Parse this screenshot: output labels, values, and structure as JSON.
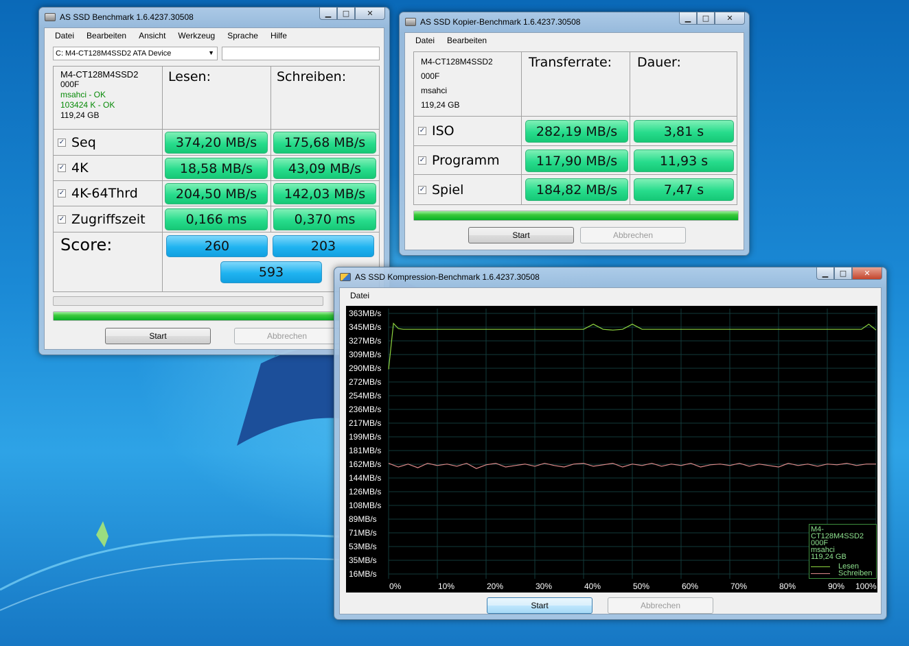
{
  "main_window": {
    "title": "AS SSD Benchmark 1.6.4237.30508",
    "menu": [
      "Datei",
      "Bearbeiten",
      "Ansicht",
      "Werkzeug",
      "Sprache",
      "Hilfe"
    ],
    "drive_select": "C: M4-CT128M4SSD2 ATA Device",
    "device_info": {
      "model": "M4-CT128M4SSD2",
      "firmware": "000F",
      "driver": "msahci - OK",
      "alignment": "103424 K - OK",
      "size": "119,24 GB"
    },
    "col_read": "Lesen:",
    "col_write": "Schreiben:",
    "rows": [
      {
        "label": "Seq",
        "read": "374,20 MB/s",
        "write": "175,68 MB/s"
      },
      {
        "label": "4K",
        "read": "18,58 MB/s",
        "write": "43,09 MB/s"
      },
      {
        "label": "4K-64Thrd",
        "read": "204,50 MB/s",
        "write": "142,03 MB/s"
      },
      {
        "label": "Zugriffszeit",
        "read": "0,166 ms",
        "write": "0,370 ms"
      }
    ],
    "score_label": "Score:",
    "score_read": "260",
    "score_write": "203",
    "score_total": "593",
    "progress_fraction": 1.0,
    "start_label": "Start",
    "abort_label": "Abbrechen"
  },
  "copy_window": {
    "title": "AS SSD Kopier-Benchmark 1.6.4237.30508",
    "menu": [
      "Datei",
      "Bearbeiten"
    ],
    "device_info": {
      "model": "M4-CT128M4SSD2",
      "firmware": "000F",
      "driver": "msahci",
      "size": "119,24 GB"
    },
    "col_rate": "Transferrate:",
    "col_time": "Dauer:",
    "rows": [
      {
        "label": "ISO",
        "rate": "282,19 MB/s",
        "time": "3,81 s"
      },
      {
        "label": "Programm",
        "rate": "117,90 MB/s",
        "time": "11,93 s"
      },
      {
        "label": "Spiel",
        "rate": "184,82 MB/s",
        "time": "7,47 s"
      }
    ],
    "progress_fraction": 1.0,
    "start_label": "Start",
    "abort_label": "Abbrechen"
  },
  "compression_window": {
    "title": "AS SSD Kompression-Benchmark 1.6.4237.30508",
    "menu": [
      "Datei"
    ],
    "start_label": "Start",
    "abort_label": "Abbrechen",
    "legend": {
      "model": "M4-CT128M4SSD2",
      "firmware": "000F",
      "driver": "msahci",
      "size": "119,24 GB",
      "read_label": "Lesen",
      "write_label": "Schreiben"
    }
  },
  "colors": {
    "read_line": "#8fd640",
    "write_line": "#e08a8a",
    "grid": "#123a3a",
    "pill_green": "#27dc8c",
    "pill_blue": "#1fb3f0",
    "progress_green": "#06b025"
  },
  "chart_data": {
    "type": "line",
    "xlabel": "",
    "ylabel": "",
    "y_tick_labels": [
      "363MB/s",
      "345MB/s",
      "327MB/s",
      "309MB/s",
      "290MB/s",
      "272MB/s",
      "254MB/s",
      "236MB/s",
      "217MB/s",
      "199MB/s",
      "181MB/s",
      "162MB/s",
      "144MB/s",
      "126MB/s",
      "108MB/s",
      "89MB/s",
      "71MB/s",
      "53MB/s",
      "35MB/s",
      "16MB/s"
    ],
    "x_tick_labels": [
      "0%",
      "10%",
      "20%",
      "30%",
      "40%",
      "50%",
      "60%",
      "70%",
      "80%",
      "90%",
      "100%"
    ],
    "x_tick_values": [
      0,
      10,
      20,
      30,
      40,
      50,
      60,
      70,
      80,
      90,
      100
    ],
    "xlim": [
      0,
      100
    ],
    "ylim": [
      7,
      372
    ],
    "grid": true,
    "legend_position": "bottom-right",
    "series": [
      {
        "name": "Lesen",
        "x": [
          0,
          1,
          2,
          3,
          5,
          10,
          20,
          30,
          40,
          42,
          44,
          46,
          48,
          50,
          52,
          60,
          70,
          80,
          90,
          95,
          97,
          98.5,
          100
        ],
        "y": [
          290,
          352,
          345,
          344,
          344,
          344,
          344,
          344,
          344,
          351,
          344,
          343,
          344,
          351,
          344,
          344,
          344,
          344,
          344,
          344,
          344,
          351,
          343
        ]
      },
      {
        "name": "Schreiben",
        "x": [
          0,
          2,
          4,
          6,
          8,
          10,
          12,
          14,
          16,
          18,
          20,
          22,
          24,
          26,
          28,
          30,
          32,
          34,
          36,
          38,
          40,
          42,
          44,
          46,
          48,
          50,
          52,
          54,
          56,
          58,
          60,
          62,
          64,
          66,
          68,
          70,
          72,
          74,
          76,
          78,
          80,
          82,
          84,
          86,
          88,
          90,
          92,
          94,
          96,
          98,
          100
        ],
        "y": [
          163,
          158,
          162,
          157,
          163,
          160,
          162,
          159,
          163,
          156,
          161,
          163,
          158,
          160,
          162,
          159,
          163,
          160,
          158,
          162,
          163,
          159,
          161,
          163,
          158,
          162,
          160,
          163,
          159,
          162,
          160,
          163,
          158,
          161,
          162,
          160,
          163,
          159,
          162,
          160,
          158,
          163,
          160,
          162,
          159,
          162,
          161,
          163,
          160,
          162,
          162
        ]
      }
    ]
  }
}
